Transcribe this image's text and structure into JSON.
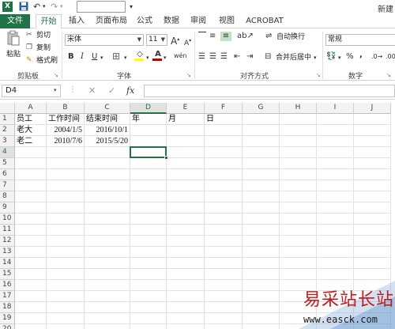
{
  "titlebar": {
    "app_icon": "X",
    "save_icon": "floppy-disk-icon",
    "undo_glyph": "↶",
    "redo_glyph": "↷",
    "dropdown_glyph": "▾",
    "title_right": "新建"
  },
  "tabs": {
    "file": "文件",
    "home": "开始",
    "insert": "插入",
    "layout": "页面布局",
    "formulas": "公式",
    "data": "数据",
    "review": "审阅",
    "view": "视图",
    "acrobat": "ACROBAT"
  },
  "ribbon": {
    "clipboard": {
      "paste": "粘贴",
      "cut": "剪切",
      "copy": "复制",
      "format_painter": "格式刷",
      "label": "剪贴板"
    },
    "font": {
      "name": "宋体",
      "size": "11",
      "grow": "A",
      "shrink": "A",
      "bold": "B",
      "italic": "I",
      "underline": "U",
      "phonetic": "wén",
      "label": "字体",
      "font_color": "#c00000",
      "fill_color": "#ffff00"
    },
    "alignment": {
      "wrap": "自动换行",
      "merge": "合并后居中",
      "label": "对齐方式"
    },
    "number": {
      "format": "常规",
      "percent": "%",
      "comma": ",",
      "label": "数字"
    }
  },
  "formula_bar": {
    "name_box": "D4",
    "cancel": "✕",
    "enter": "✓",
    "fx": "fx",
    "value": ""
  },
  "sheet": {
    "columns": [
      "A",
      "B",
      "C",
      "D",
      "E",
      "F",
      "G",
      "H",
      "I",
      "J"
    ],
    "rows": [
      "1",
      "2",
      "3",
      "4",
      "5",
      "6",
      "7",
      "8",
      "9",
      "10",
      "11",
      "12",
      "13",
      "14",
      "15",
      "16",
      "17",
      "18",
      "19",
      "20"
    ],
    "selected_cell": "D4",
    "cells": {
      "A1": "员工",
      "B1": "工作时间",
      "C1": "结束时间",
      "D1": "年",
      "E1": "月",
      "F1": "日",
      "A2": "老大",
      "B2": "2004/1/5",
      "C2": "2016/10/1",
      "A3": "老二",
      "B3": "2010/7/6",
      "C3": "2015/5/20"
    }
  },
  "watermark": {
    "title": "易采站长站",
    "url": "www.easck.com"
  }
}
